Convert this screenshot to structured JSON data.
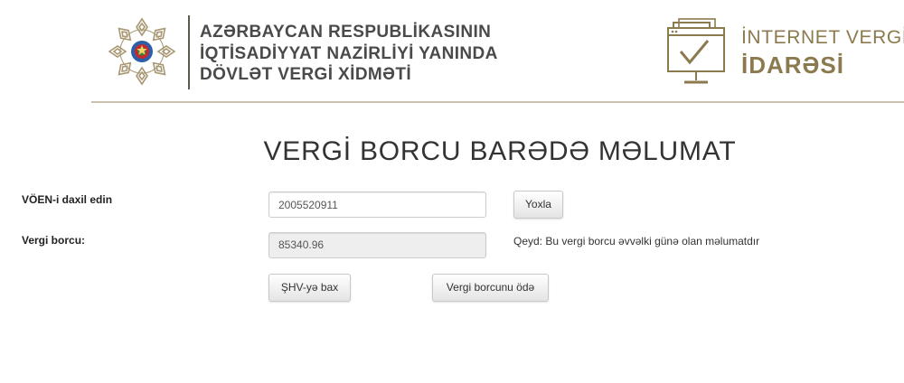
{
  "header": {
    "ministry_lines": [
      "AZƏRBAYCAN RESPUBLİKASININ",
      "İQTİSADİYYAT NAZİRLİYİ YANINDA",
      "DÖVLƏT VERGİ XİDMƏTİ"
    ],
    "portal_lines": [
      "İNTERNET VERGİ",
      "İDARƏSİ"
    ],
    "emblem_icon": "state-emblem-icon",
    "portal_icon": "monitor-checkmark-icon"
  },
  "title": "VERGİ BORCU BARƏDƏ MƏLUMAT",
  "form": {
    "voen_label": "VÖEN-i daxil edin",
    "voen_value": "2005520911",
    "check_label": "Yoxla",
    "debt_label": "Vergi borcu:",
    "debt_value": "85340.96",
    "note": "Qeyd: Bu vergi borcu əvvəlki günə olan məlumatdır",
    "shv_label": "ŞHV-yə bax",
    "pay_label": "Vergi borcunu ödə"
  },
  "colors": {
    "gold": "#8c7a4f",
    "text_dark": "#4a4a4a",
    "rule": "#c9c1ae",
    "emblem_blue": "#2b5fa8",
    "emblem_red": "#c8282d",
    "emblem_green": "#2e8b3a"
  }
}
